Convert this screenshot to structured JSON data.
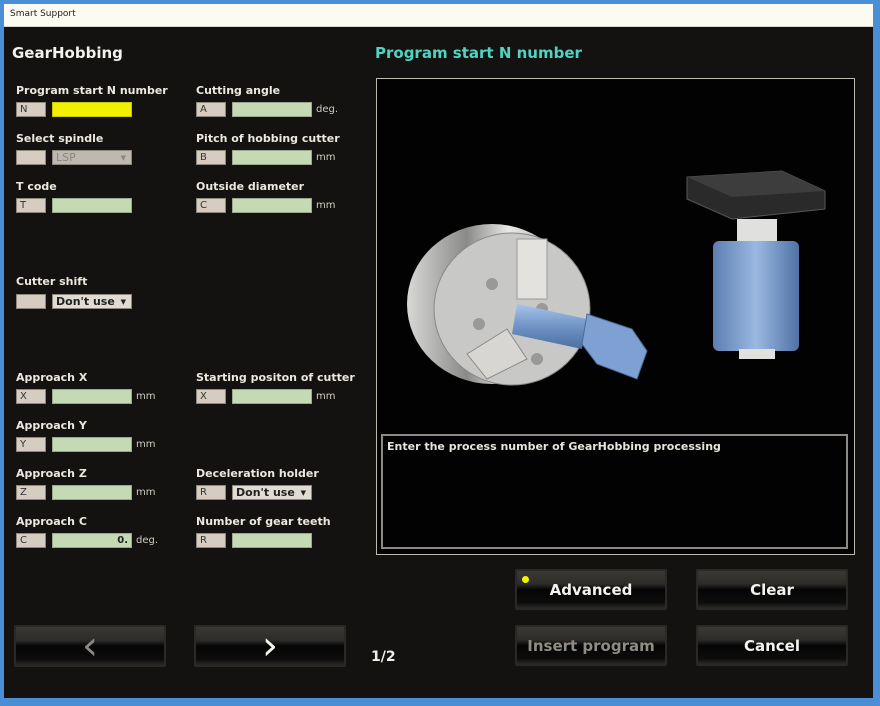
{
  "window": {
    "title": "Smart Support"
  },
  "heading": "GearHobbing",
  "fields_left": [
    {
      "label": "Program start N number",
      "prefix": "N",
      "value": "",
      "unit": "",
      "highlight": true
    },
    {
      "label": "Select spindle",
      "prefix": "",
      "select": "LSP",
      "disabled": true
    },
    {
      "label": "T code",
      "prefix": "T",
      "value": "",
      "unit": ""
    },
    {
      "label": "Cutter shift",
      "prefix": "",
      "select": "Don't use"
    },
    {
      "label": "Approach X",
      "prefix": "X",
      "value": "",
      "unit": "mm"
    },
    {
      "label": "Approach Y",
      "prefix": "Y",
      "value": "",
      "unit": "mm"
    },
    {
      "label": "Approach Z",
      "prefix": "Z",
      "value": "",
      "unit": "mm"
    },
    {
      "label": "Approach C",
      "prefix": "C",
      "value": "0.",
      "unit": "deg."
    }
  ],
  "fields_right": [
    {
      "label": "Cutting angle",
      "prefix": "A",
      "value": "",
      "unit": "deg."
    },
    {
      "label": "Pitch of hobbing cutter",
      "prefix": "B",
      "value": "",
      "unit": "mm"
    },
    {
      "label": "Outside diameter",
      "prefix": "C",
      "value": "",
      "unit": "mm"
    },
    {
      "label": "Starting positon of cutter",
      "prefix": "X",
      "value": "",
      "unit": "mm"
    },
    {
      "label": "Deceleration holder",
      "prefix": "R",
      "select": "Don't use"
    },
    {
      "label": "Number of gear teeth",
      "prefix": "R",
      "value": "",
      "unit": ""
    }
  ],
  "select_arrow": "▼",
  "right_panel": {
    "title": "Program start N number",
    "image": "gear-hobbing-illustration",
    "message": "Enter the process number of GearHobbing processing"
  },
  "buttons": {
    "advanced": "Advanced",
    "clear": "Clear",
    "insert_program": "Insert program",
    "cancel": "Cancel",
    "prev_icon": "‹",
    "next_icon": "›"
  },
  "pagination": "1/2",
  "colors": {
    "accent": "#4fd4c2",
    "highlight_field": "#f0f000",
    "indicator": "#f4f400"
  }
}
